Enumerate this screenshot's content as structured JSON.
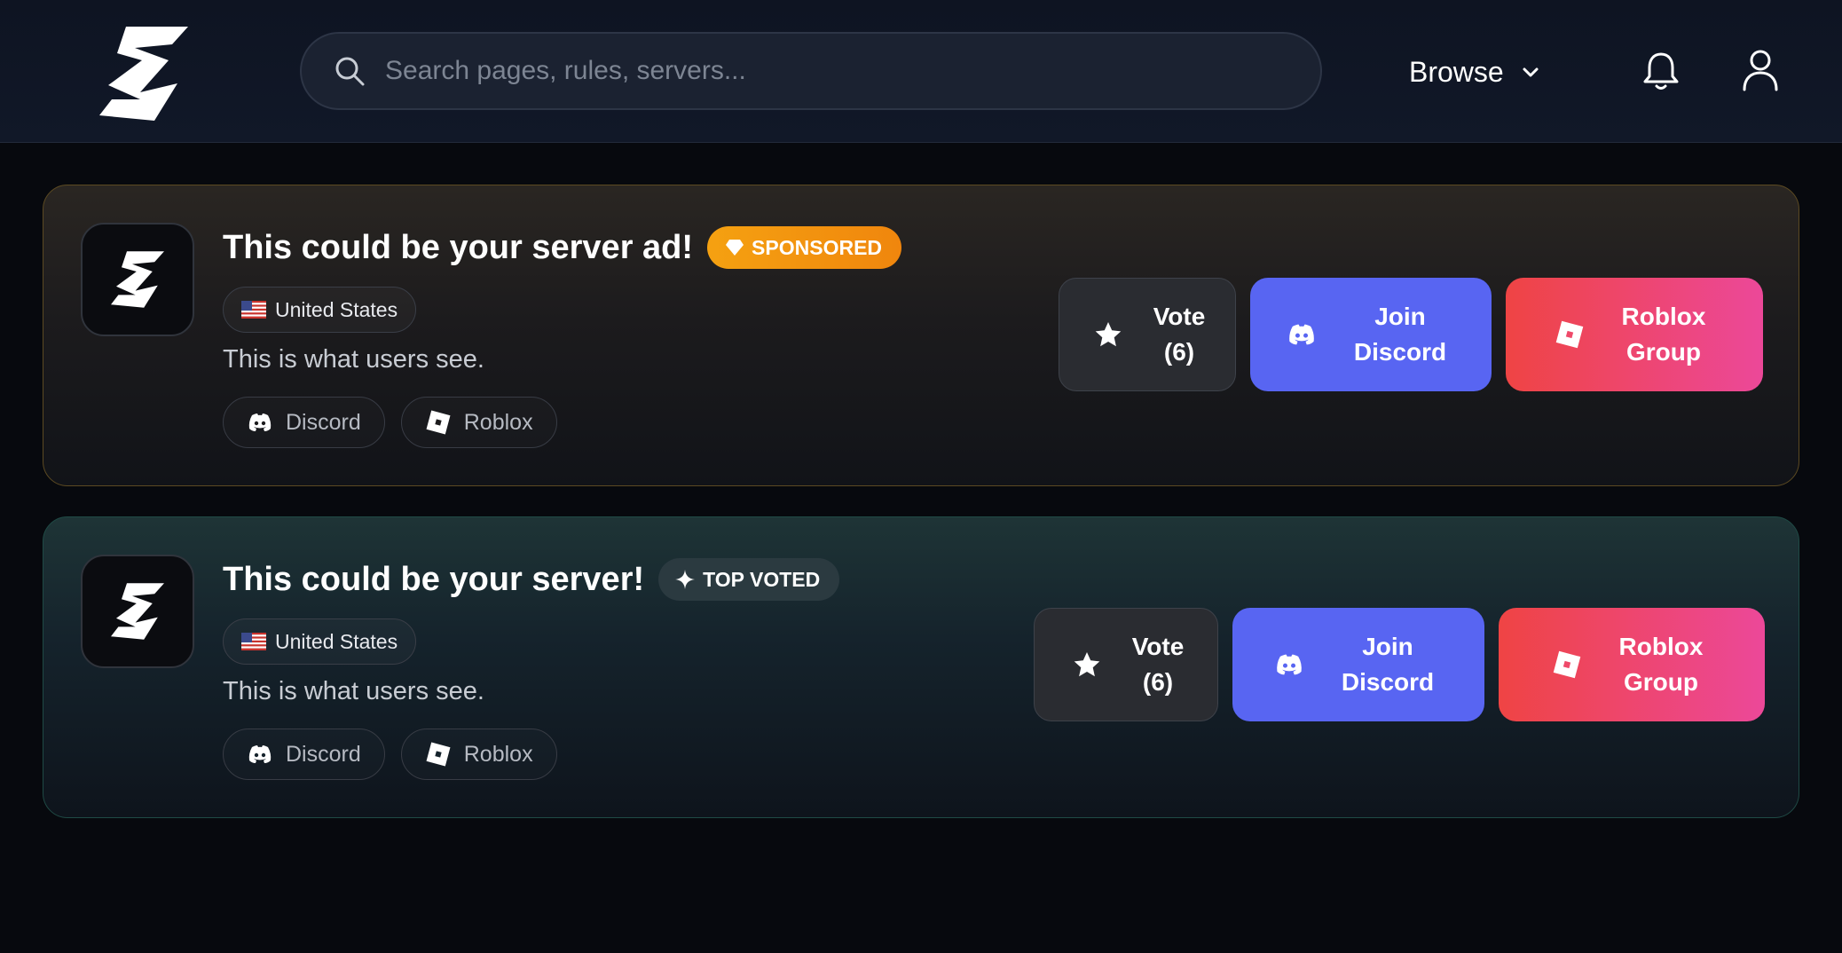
{
  "header": {
    "search_placeholder": "Search pages, rules, servers...",
    "browse_label": "Browse"
  },
  "cards": [
    {
      "title": "This could be your server ad!",
      "badge": "SPONSORED",
      "country": "United States",
      "description": "This is what users see.",
      "chips": [
        "Discord",
        "Roblox"
      ],
      "vote_label": "Vote",
      "vote_count": "(6)",
      "join_line1": "Join",
      "join_line2": "Discord",
      "roblox_line1": "Roblox",
      "roblox_line2": "Group"
    },
    {
      "title": "This could be your server!",
      "badge": "TOP VOTED",
      "country": "United States",
      "description": "This is what users see.",
      "chips": [
        "Discord",
        "Roblox"
      ],
      "vote_label": "Vote",
      "vote_count": "(6)",
      "join_line1": "Join",
      "join_line2": "Discord",
      "roblox_line1": "Roblox",
      "roblox_line2": "Group"
    }
  ],
  "colors": {
    "discord": "#5865f2",
    "roblox_start": "#ef4444",
    "roblox_end": "#ec4899",
    "sponsored": "#f5a111"
  },
  "icons": [
    "lightning-logo-icon",
    "search-icon",
    "chevron-down-icon",
    "bell-icon",
    "user-icon",
    "diamond-icon",
    "sparkle-icon",
    "us-flag-icon",
    "discord-icon",
    "roblox-icon",
    "star-icon"
  ]
}
